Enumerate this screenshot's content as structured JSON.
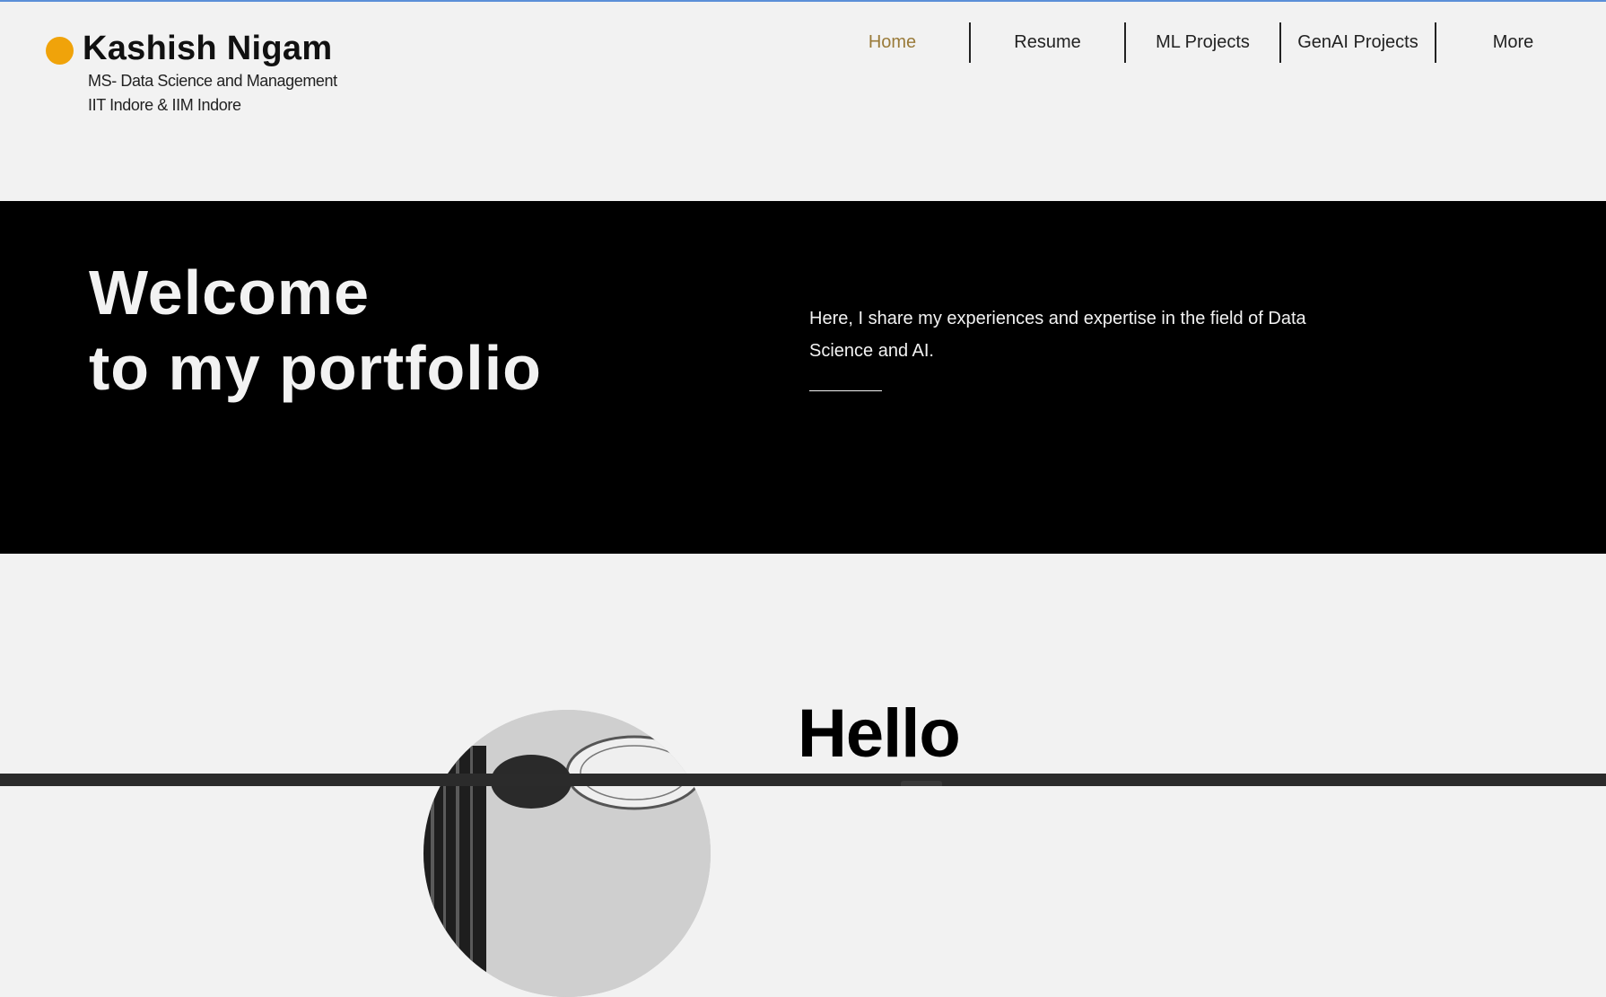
{
  "header": {
    "brand_name": "Kashish Nigam",
    "subtitle_line1": "MS- Data Science and Management",
    "subtitle_line2": "IIT Indore & IIM Indore"
  },
  "nav": {
    "items": [
      {
        "label": "Home",
        "active": true
      },
      {
        "label": "Resume"
      },
      {
        "label": "ML Projects"
      },
      {
        "label": "GenAI Projects"
      },
      {
        "label": "More"
      }
    ]
  },
  "hero": {
    "title_line1": "Welcome",
    "title_line2": "to my portfolio",
    "description": "Here, I share my experiences and expertise in the field of Data Science and AI."
  },
  "about": {
    "heading": "Hello"
  },
  "colors": {
    "accent_dot": "#f0a30a",
    "active_nav": "#9a7b3a",
    "hero_background": "#000000",
    "page_background": "#f2f2f2"
  }
}
